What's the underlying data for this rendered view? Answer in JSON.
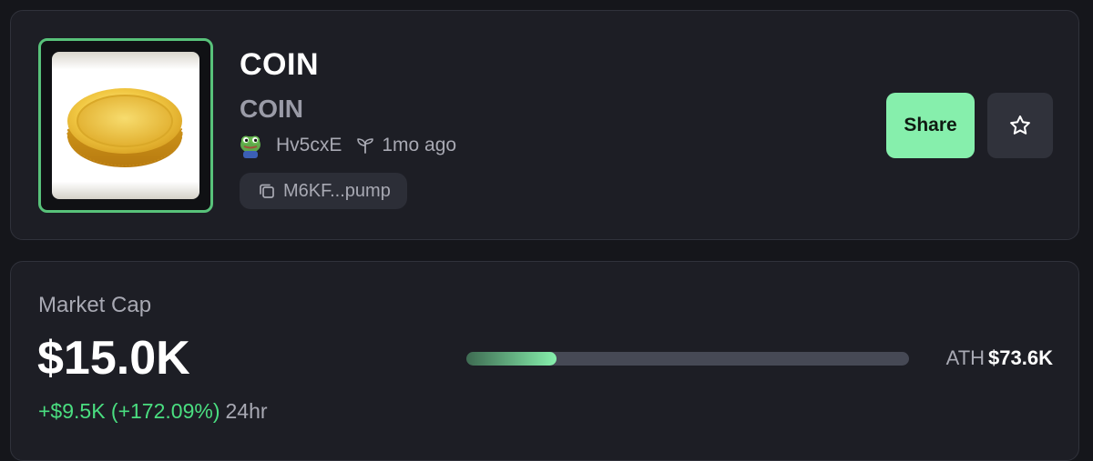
{
  "token": {
    "name": "COIN",
    "symbol": "COIN",
    "creator": "Hv5cxE",
    "age": "1mo ago",
    "address_short": "M6KF...pump",
    "image_icon": "gold-coin-icon",
    "avatar_icon": "pepe-avatar-icon"
  },
  "actions": {
    "share_label": "Share",
    "favorite_icon": "star-icon"
  },
  "market": {
    "label": "Market Cap",
    "value": "$15.0K",
    "change": "+$9.5K (+172.09%)",
    "period": "24hr",
    "ath_label": "ATH",
    "ath_value": "$73.6K",
    "ath_progress": 0.204
  },
  "colors": {
    "accent_green": "#86efac",
    "positive": "#4ade80",
    "background": "#15161b",
    "card": "#1d1e25"
  }
}
